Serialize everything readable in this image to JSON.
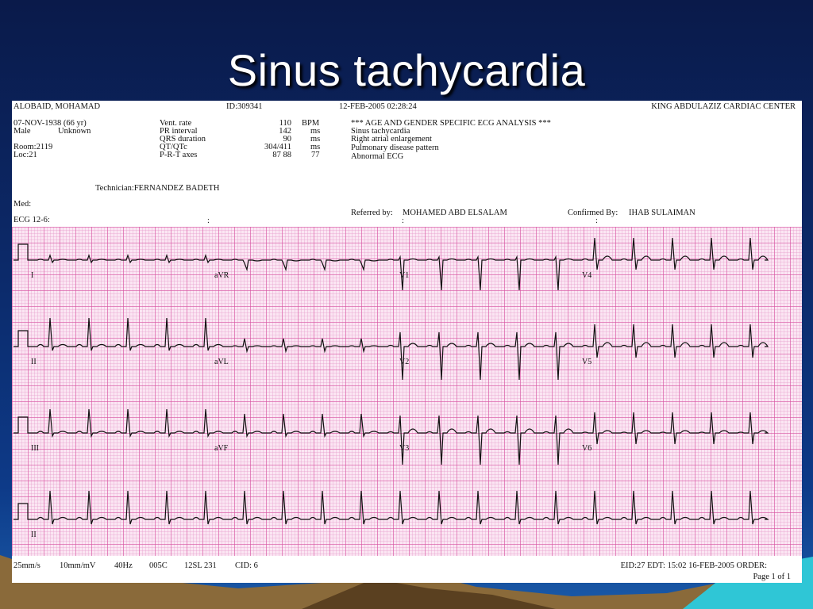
{
  "slide": {
    "title": "Sinus tachycardia"
  },
  "header": {
    "patient_name": "ALOBAID, MOHAMAD",
    "id": "ID:309341",
    "datetime": "12-FEB-2005  02:28:24",
    "center": "KING ABDULAZIZ CARDIAC CENTER",
    "dob": "07-NOV-1938 (66 yr)",
    "sex": "Male",
    "race": "Unknown",
    "room": "Room:2119",
    "loc": "Loc:21"
  },
  "measurements": [
    {
      "label": "Vent. rate",
      "value": "110",
      "unit": "BPM"
    },
    {
      "label": "PR interval",
      "value": "142",
      "unit": "ms"
    },
    {
      "label": "QRS duration",
      "value": "90",
      "unit": "ms"
    },
    {
      "label": "QT/QTc",
      "value": "304/411",
      "unit": "ms"
    },
    {
      "label": "P-R-T axes",
      "value": "87  88",
      "unit": "77"
    }
  ],
  "analysis": [
    "*** AGE AND GENDER SPECIFIC ECG ANALYSIS ***",
    "Sinus tachycardia",
    "Right atrial enlargement",
    "Pulmonary disease pattern",
    "Abnormal ECG"
  ],
  "staff": {
    "technician": "Technician:FERNANDEZ BADETH",
    "med": "Med:",
    "referred_label": "Referred by:",
    "referred_name": "MOHAMED ABD ELSALAM",
    "confirmed_label": "Confirmed By:",
    "confirmed_name": "IHAB SULAIMAN",
    "ecg_label": "ECG 12-6:",
    "colon": ":"
  },
  "leads": {
    "row1": [
      "I",
      "aVR",
      "V1",
      "V4"
    ],
    "row2": [
      "II",
      "aVL",
      "V2",
      "V5"
    ],
    "row3": [
      "III",
      "aVF",
      "V3",
      "V6"
    ],
    "row4": [
      "II"
    ]
  },
  "footer": {
    "speed": "25mm/s",
    "gain": "10mm/mV",
    "filter": "40Hz",
    "code1": "005C",
    "code2": "12SL 231",
    "cid": "CID: 6",
    "eid": "EID:27 EDT: 15:02 16-FEB-2005 ORDER:",
    "page": "Page 1 of 1"
  },
  "colors": {
    "trace": "#111111",
    "grid_major": "#d750a0",
    "grid_bg": "#fbe6f3"
  }
}
